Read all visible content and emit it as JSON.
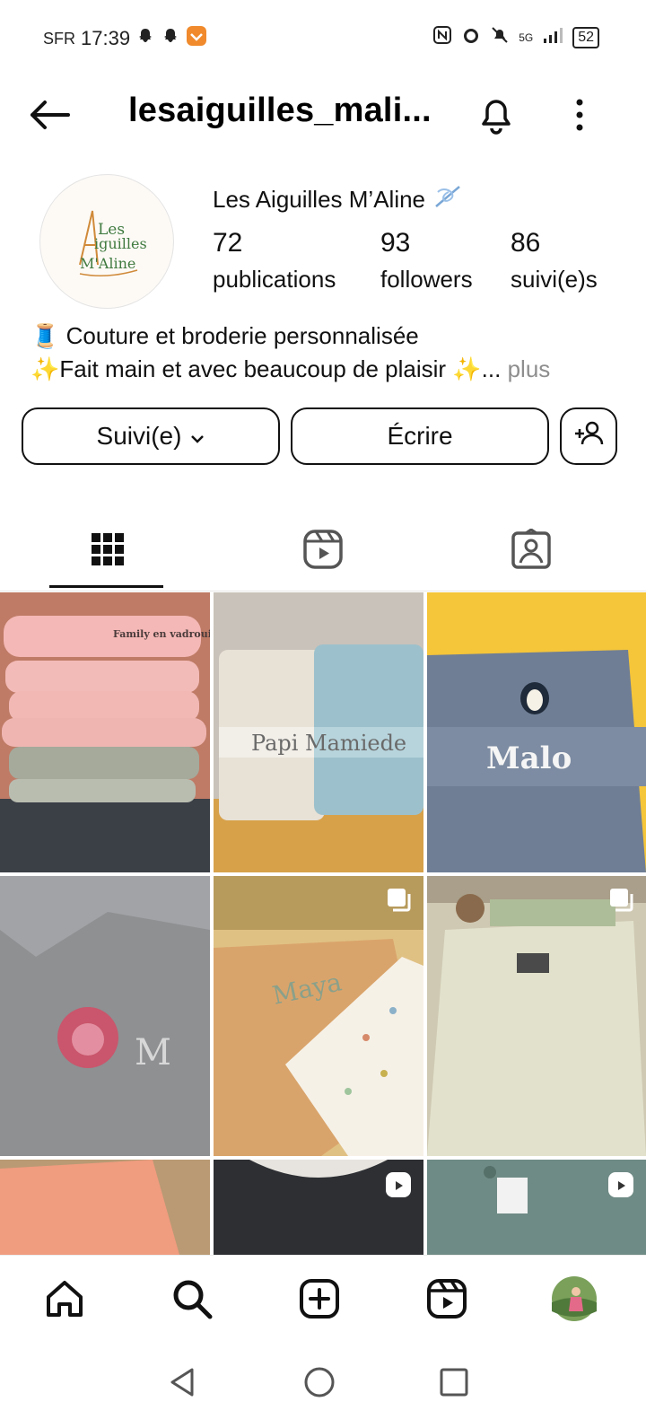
{
  "status_bar": {
    "carrier": "SFR",
    "time": "17:39",
    "network": "5G",
    "battery": "52"
  },
  "header": {
    "username": "lesaiguilles_mali..."
  },
  "profile": {
    "avatar_text": [
      "Les",
      "iguilles",
      "M'Aline"
    ],
    "display_name": "Les Aiguilles M’Aline",
    "stats": [
      {
        "value": "72",
        "label": "publications"
      },
      {
        "value": "93",
        "label": "followers"
      },
      {
        "value": "86",
        "label": "suivi(e)s"
      }
    ],
    "bio_lines": [
      "🧵 Couture et broderie personnalisée",
      "✨Fait main et avec beaucoup de plaisir ✨..."
    ],
    "bio_more": "plus"
  },
  "actions": {
    "follow_label": "Suivi(e)",
    "message_label": "Écrire"
  },
  "tabs": [
    {
      "icon": "grid-icon",
      "active": true
    },
    {
      "icon": "reels-icon",
      "active": false
    },
    {
      "icon": "tagged-icon",
      "active": false
    }
  ],
  "posts": [
    {
      "caption_text": "Family en vadrouille",
      "badge": ""
    },
    {
      "caption_text": "Papi Mamiede",
      "badge": ""
    },
    {
      "caption_text": "Malo",
      "badge": ""
    },
    {
      "caption_text": "M",
      "badge": ""
    },
    {
      "caption_text": "Maya",
      "badge": "carousel-icon"
    },
    {
      "caption_text": "",
      "badge": "carousel-icon"
    },
    {
      "caption_text": "",
      "badge": ""
    },
    {
      "caption_text": "",
      "badge": "reels-icon"
    },
    {
      "caption_text": "",
      "badge": "reels-icon"
    }
  ],
  "bottom_nav": [
    "home-icon",
    "search-icon",
    "create-icon",
    "reels-icon",
    "profile-avatar"
  ],
  "colors": {
    "text": "#111111",
    "muted": "#8e8e8e",
    "accent_thread": "#1d6fc4"
  }
}
